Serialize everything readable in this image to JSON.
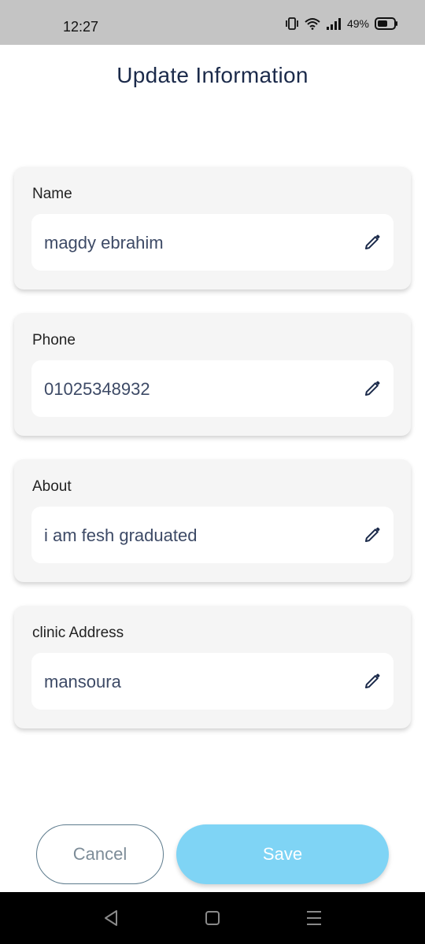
{
  "status_bar": {
    "time": "12:27",
    "battery_percent": "49%",
    "icons": [
      "vibrate-icon",
      "wifi-icon",
      "signal-icon",
      "battery-icon"
    ]
  },
  "header": {
    "title": "Update Information"
  },
  "fields": [
    {
      "label": "Name",
      "value": "magdy ebrahim",
      "icon": "pencil-icon"
    },
    {
      "label": "Phone",
      "value": "01025348932",
      "icon": "pencil-icon"
    },
    {
      "label": "About",
      "value": "i am fesh graduated",
      "icon": "pencil-icon"
    },
    {
      "label": "clinic Address",
      "value": "mansoura",
      "icon": "pencil-icon"
    }
  ],
  "actions": {
    "cancel_label": "Cancel",
    "save_label": "Save"
  },
  "nav_bar": {
    "icons": [
      "back-icon",
      "home-icon",
      "recent-apps-icon"
    ]
  },
  "colors": {
    "title": "#1b2a4a",
    "field_value": "#3d4a66",
    "save_button": "#7fd4f5",
    "cancel_border": "#5c7a8c",
    "status_bar": "#c4c4c4"
  }
}
